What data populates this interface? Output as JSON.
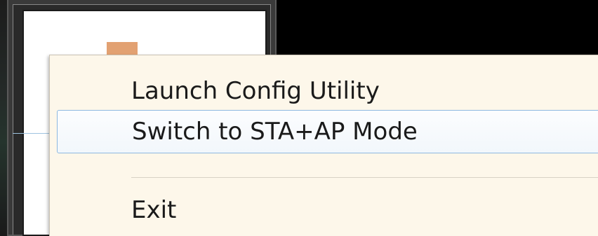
{
  "context_menu": {
    "items": [
      {
        "label": "Launch Config Utility"
      },
      {
        "label": "Switch to STA+AP Mode",
        "highlighted": true
      },
      {
        "label": "Exit"
      }
    ]
  },
  "colors": {
    "menu_background": "#fdf7ea",
    "highlight_border": "#8db8e0",
    "accent_tab": "#e2a172"
  }
}
